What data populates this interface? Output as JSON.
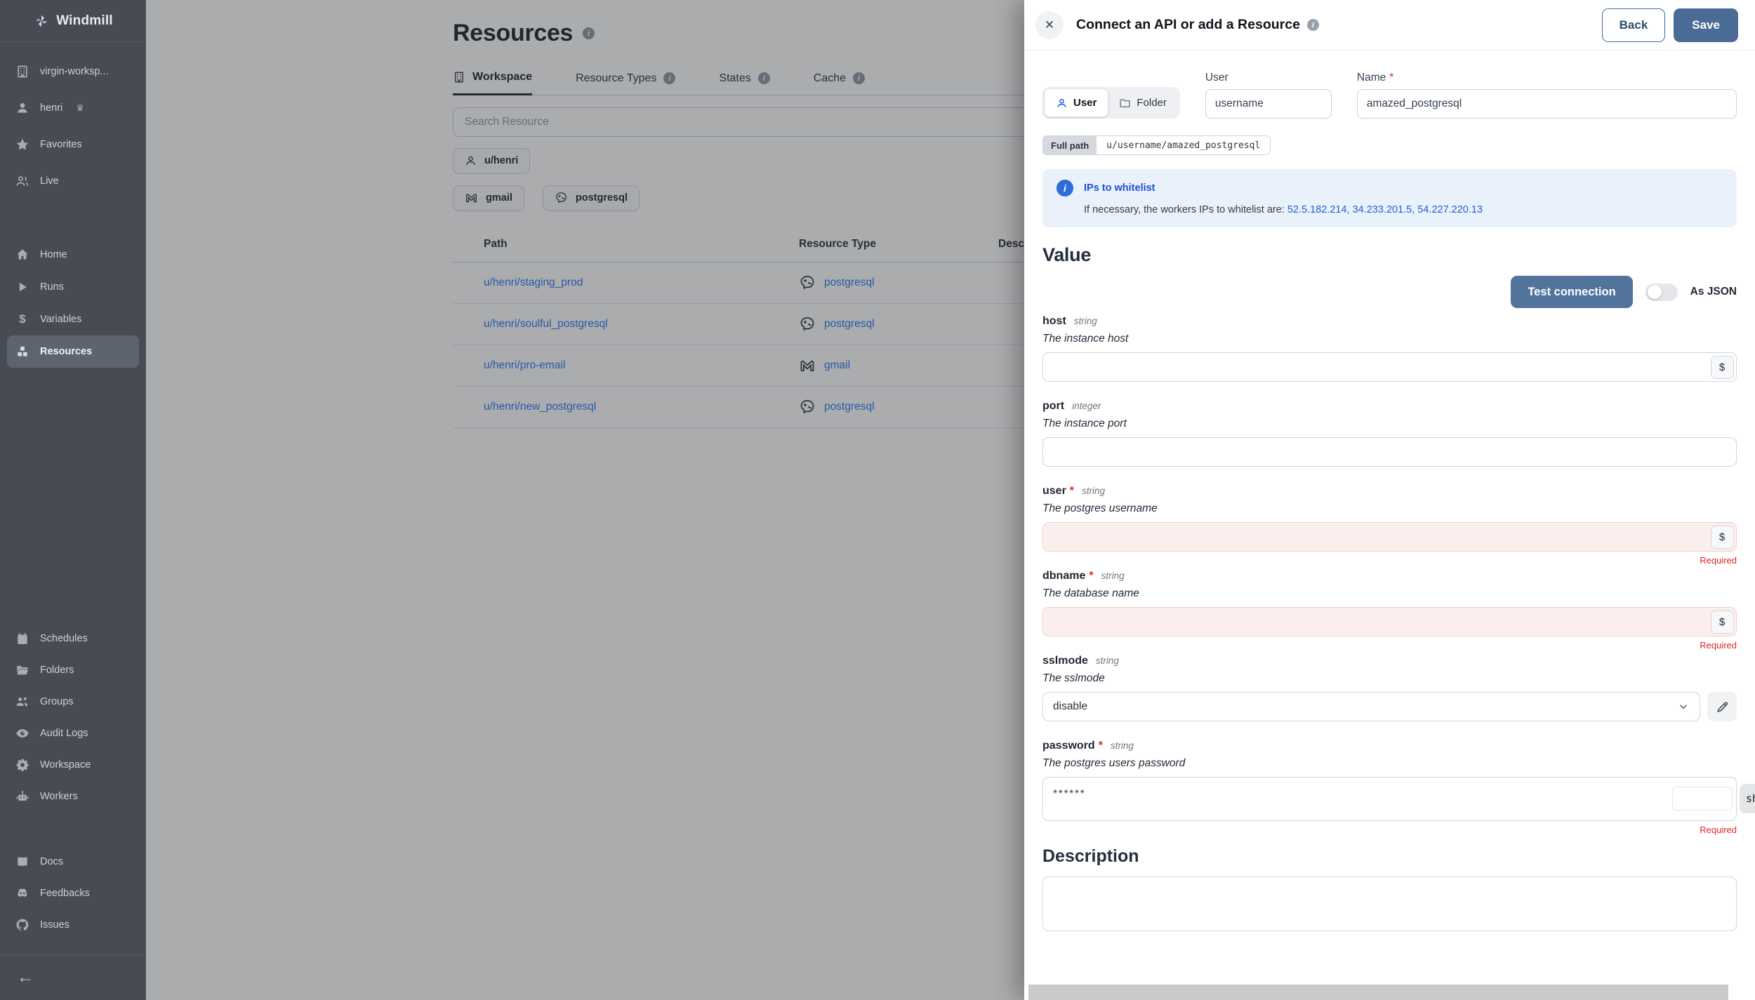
{
  "colors": {
    "accent_blue": "#4a6c94",
    "link_blue": "#3b82f6",
    "error_red": "#dc2626",
    "info_bg": "#e9f1fb",
    "sidebar_bg": "#474b54"
  },
  "icons": {
    "close": "✕",
    "back_arrow": "←",
    "dollar": "$",
    "crown": "♛",
    "variables_glyph": "$"
  },
  "sidebar": {
    "brand": "Windmill",
    "top": [
      {
        "label": "virgin-worksp..."
      },
      {
        "label": "henri"
      },
      {
        "label": "Favorites"
      },
      {
        "label": "Live"
      }
    ],
    "nav": [
      {
        "label": "Home"
      },
      {
        "label": "Runs"
      },
      {
        "label": "Variables"
      },
      {
        "label": "Resources"
      }
    ],
    "admin": [
      {
        "label": "Schedules"
      },
      {
        "label": "Folders"
      },
      {
        "label": "Groups"
      },
      {
        "label": "Audit Logs"
      },
      {
        "label": "Workspace"
      },
      {
        "label": "Workers"
      }
    ],
    "footer": [
      {
        "label": "Docs"
      },
      {
        "label": "Feedbacks"
      },
      {
        "label": "Issues"
      }
    ]
  },
  "main": {
    "title": "Resources",
    "tabs": [
      {
        "label": "Workspace"
      },
      {
        "label": "Resource Types"
      },
      {
        "label": "States"
      },
      {
        "label": "Cache"
      }
    ],
    "search_placeholder": "Search Resource",
    "owner_chip": "u/henri",
    "type_chips": [
      {
        "label": "gmail"
      },
      {
        "label": "postgresql"
      }
    ],
    "table": {
      "headers": {
        "path": "Path",
        "type": "Resource Type",
        "description": "Description"
      },
      "rows": [
        {
          "path": "u/henri/staging_prod",
          "type": "postgresql"
        },
        {
          "path": "u/henri/soulful_postgresql",
          "type": "postgresql"
        },
        {
          "path": "u/henri/pro-email",
          "type": "gmail"
        },
        {
          "path": "u/henri/new_postgresql",
          "type": "postgresql"
        }
      ]
    }
  },
  "drawer": {
    "title": "Connect an API or add a Resource",
    "back_label": "Back",
    "save_label": "Save",
    "owner_toggle": {
      "user": "User",
      "folder": "Folder"
    },
    "user_field": {
      "label": "User",
      "value": "username"
    },
    "name_field": {
      "label": "Name",
      "required_mark": "*",
      "value": "amazed_postgresql"
    },
    "full_path": {
      "label": "Full path",
      "value": "u/username/amazed_postgresql"
    },
    "info_box": {
      "title": "IPs to whitelist",
      "body": "If necessary, the workers IPs to whitelist are:",
      "ips": "52.5.182.214, 34.233.201.5, 54.227.220.13"
    },
    "value_heading": "Value",
    "test_connection_label": "Test connection",
    "as_json_label": "As JSON",
    "fields": [
      {
        "name": "host",
        "type": "string",
        "desc": "The instance host"
      },
      {
        "name": "port",
        "type": "integer",
        "desc": "The instance port"
      },
      {
        "name": "user",
        "type": "string",
        "required_mark": "*",
        "desc": "The postgres username",
        "required_label": "Required"
      },
      {
        "name": "dbname",
        "type": "string",
        "required_mark": "*",
        "desc": "The database name",
        "required_label": "Required"
      },
      {
        "name": "sslmode",
        "type": "string",
        "desc": "The sslmode",
        "value": "disable"
      },
      {
        "name": "password",
        "type": "string",
        "required_mark": "*",
        "desc": "The postgres users password",
        "value": "******",
        "required_label": "Required",
        "overflow_chip": "sh"
      }
    ],
    "description_heading": "Description"
  }
}
